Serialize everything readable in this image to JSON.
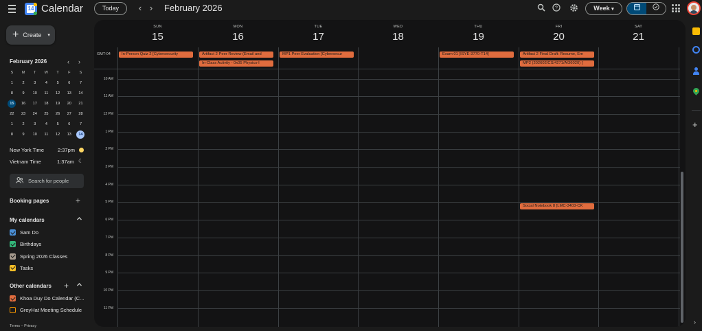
{
  "app": {
    "title": "Calendar",
    "logo_day": "14"
  },
  "header": {
    "today_label": "Today",
    "prev_glyph": "‹",
    "next_glyph": "›",
    "current_period": "February 2026",
    "search_icon": "search-icon",
    "help_icon": "help-icon",
    "settings_icon": "gear-icon",
    "view_label": "Week",
    "view_caret": "▾",
    "toggle_calendar_icon": "calendar-icon",
    "toggle_tasks_icon": "check-circle-icon",
    "apps_icon": "apps-grid-icon",
    "avatar": "account-avatar"
  },
  "sidebar": {
    "create_label": "Create",
    "mini_calendar": {
      "title": "February 2026",
      "days_of_week": [
        "S",
        "M",
        "T",
        "W",
        "T",
        "F",
        "S"
      ],
      "weeks": [
        [
          "1",
          "2",
          "3",
          "4",
          "5",
          "6",
          "7"
        ],
        [
          "8",
          "9",
          "10",
          "11",
          "12",
          "13",
          "14"
        ],
        [
          "15",
          "16",
          "17",
          "18",
          "19",
          "20",
          "21"
        ],
        [
          "22",
          "23",
          "24",
          "25",
          "26",
          "27",
          "28"
        ],
        [
          "1",
          "2",
          "3",
          "4",
          "5",
          "6",
          "7"
        ],
        [
          "8",
          "9",
          "10",
          "11",
          "12",
          "13",
          "14"
        ]
      ],
      "today_cell": "15",
      "selected_cell": "14"
    },
    "timezones": [
      {
        "label": "New York Time",
        "time": "2:37pm",
        "icon": "sun-icon"
      },
      {
        "label": "Vietnam Time",
        "time": "1:37am",
        "icon": "moon-icon"
      }
    ],
    "search_people_placeholder": "Search for people",
    "booking_pages_label": "Booking pages",
    "my_calendars_label": "My calendars",
    "my_calendars": [
      {
        "name": "Sam Do",
        "color": "#4a8fd6",
        "checked": true
      },
      {
        "name": "Birthdays",
        "color": "#33b679",
        "checked": true
      },
      {
        "name": "Spring 2026 Classes",
        "color": "#a79b8e",
        "checked": true
      },
      {
        "name": "Tasks",
        "color": "#f6bf26",
        "checked": true
      }
    ],
    "other_calendars_label": "Other calendars",
    "other_calendars": [
      {
        "name": "Khoa Duy Do Calendar (C...",
        "color": "#e06c3e",
        "checked": true
      },
      {
        "name": "GreyHat Meeting Schedule",
        "color": "#f09300",
        "checked": false
      }
    ],
    "terms": "Terms – Privacy"
  },
  "week": {
    "timezone_label": "GMT-04",
    "days": [
      {
        "dow": "SUN",
        "date": "15"
      },
      {
        "dow": "MON",
        "date": "16"
      },
      {
        "dow": "TUE",
        "date": "17"
      },
      {
        "dow": "WED",
        "date": "18"
      },
      {
        "dow": "THU",
        "date": "19"
      },
      {
        "dow": "FRI",
        "date": "20"
      },
      {
        "dow": "SAT",
        "date": "21"
      }
    ],
    "hours": [
      "10 AM",
      "11 AM",
      "12 PM",
      "1 PM",
      "2 PM",
      "3 PM",
      "4 PM",
      "5 PM",
      "6 PM",
      "7 PM",
      "8 PM",
      "9 PM",
      "10 PM",
      "11 PM"
    ],
    "all_day_events": [
      {
        "title": "In-Person Quiz 2 [Cybersecurity",
        "day": 0,
        "row": 0
      },
      {
        "title": "Artifact 2 Peer Review (Email and",
        "day": 1,
        "row": 0
      },
      {
        "title": "In-Class Activity - 0x05 Physics-I",
        "day": 1,
        "row": 1
      },
      {
        "title": "MP1 Peer Evaluation [Cybersecur",
        "day": 2,
        "row": 0
      },
      {
        "title": "Exam 01 [ISYE-3770-T14]",
        "day": 4,
        "row": 0
      },
      {
        "title": "Artifact 2 Final Draft: Resume, Em",
        "day": 5,
        "row": 0
      },
      {
        "title": "MP2 (202602/CS/4271/A/36020) [",
        "day": 5,
        "row": 1
      }
    ],
    "timed_events": [
      {
        "title": "Social Notebook 8 [LMC-3403-CK",
        "day": 5,
        "hour": 17
      }
    ],
    "event_color": "#e06c3e"
  },
  "side_panel": {
    "icons": [
      "keep-icon",
      "tasks-icon",
      "contacts-icon",
      "maps-icon"
    ],
    "add_glyph": "+",
    "expand_glyph": "›"
  }
}
